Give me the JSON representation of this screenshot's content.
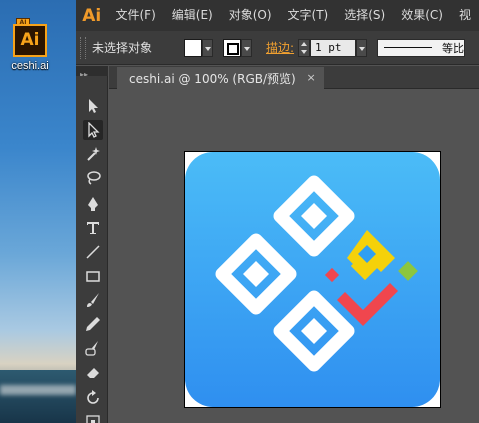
{
  "desktop": {
    "file_icon": {
      "badge": "AI",
      "glyph": "Ai",
      "name": "ceshi.ai",
      "accent": "#f7a21a"
    }
  },
  "app": {
    "logo": "Ai",
    "logo_color": "#f09a2a",
    "menus": [
      "文件(F)",
      "编辑(E)",
      "对象(O)",
      "文字(T)",
      "选择(S)",
      "效果(C)",
      "视"
    ]
  },
  "control_bar": {
    "selection_status": "未选择对象",
    "fill_color": "#ffffff",
    "stroke_label": "描边:",
    "stroke_weight": "1 pt",
    "profile_label": "等比"
  },
  "document": {
    "tab_title": "ceshi.ai @ 100% (RGB/预览)",
    "close_glyph": "×"
  },
  "tools": [
    {
      "name": "selection-tool-icon",
      "active": false
    },
    {
      "name": "direct-selection-tool-icon",
      "active": true
    },
    {
      "name": "magic-wand-tool-icon",
      "active": false
    },
    {
      "name": "lasso-tool-icon",
      "active": false
    },
    {
      "name": "pen-tool-icon",
      "active": false
    },
    {
      "name": "type-tool-icon",
      "active": false
    },
    {
      "name": "line-segment-tool-icon",
      "active": false
    },
    {
      "name": "rectangle-tool-icon",
      "active": false
    },
    {
      "name": "paintbrush-tool-icon",
      "active": false
    },
    {
      "name": "pencil-tool-icon",
      "active": false
    },
    {
      "name": "blob-brush-tool-icon",
      "active": false
    },
    {
      "name": "eraser-tool-icon",
      "active": false
    },
    {
      "name": "rotate-tool-icon",
      "active": false
    },
    {
      "name": "scale-tool-icon",
      "active": false
    }
  ],
  "artwork": {
    "background_top": "#4bbcf7",
    "background_bottom": "#2f8ff0",
    "diamond_color": "#ffffff",
    "yellow": "#f5d10a",
    "green": "#8cc63f",
    "red": "#f0464e"
  }
}
